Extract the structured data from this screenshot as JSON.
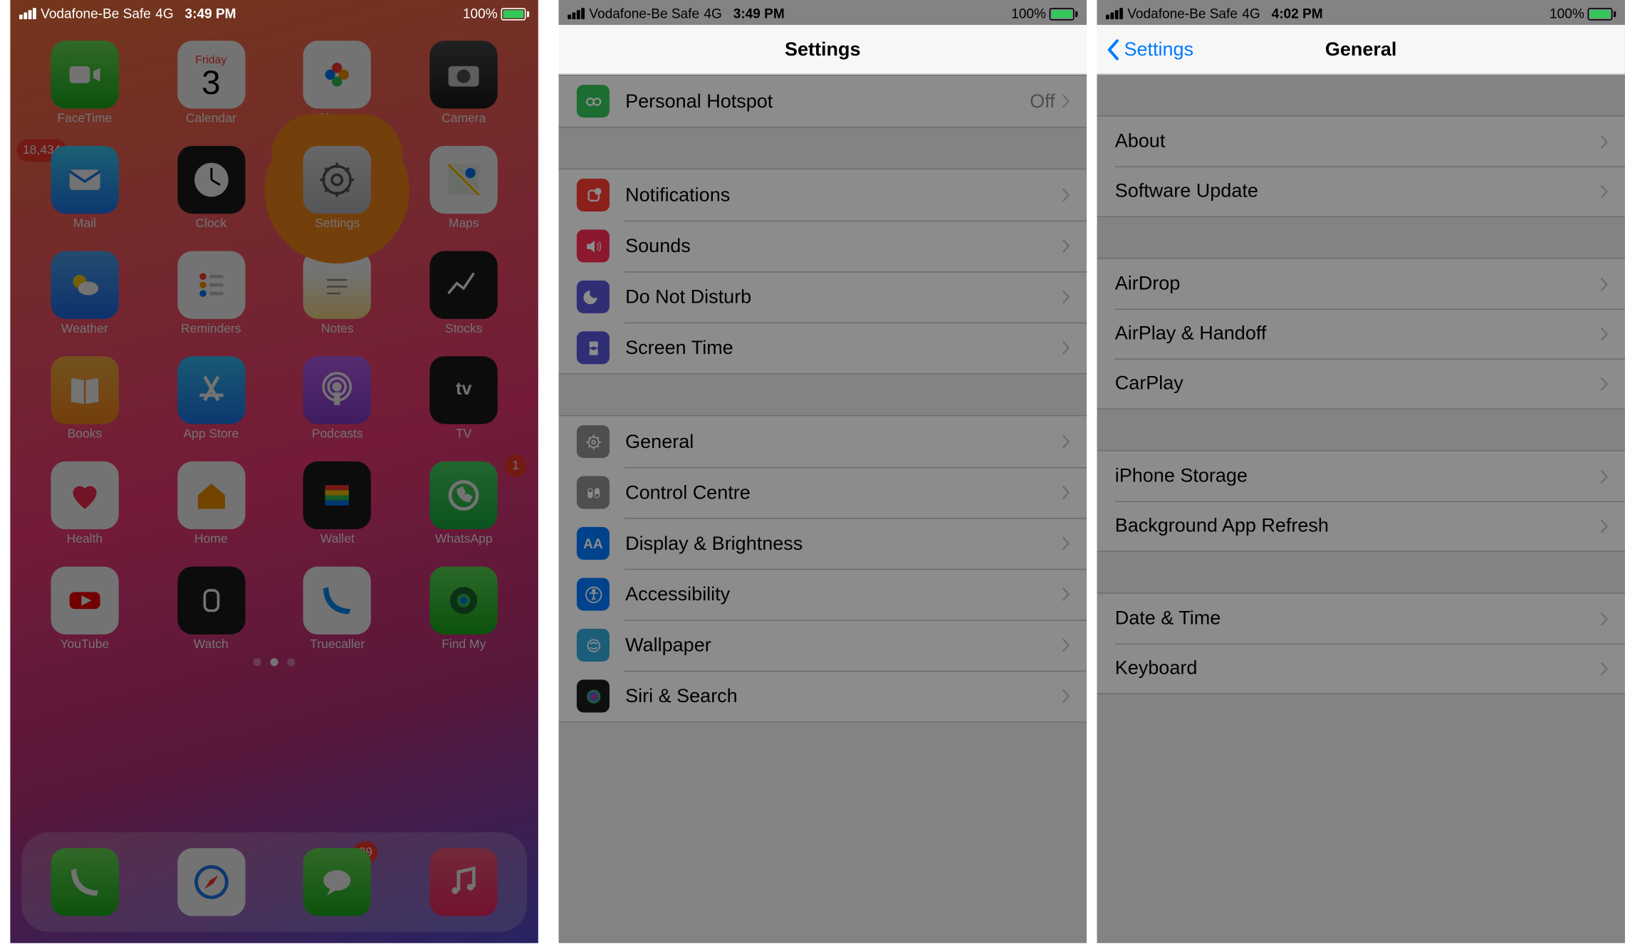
{
  "status": {
    "carrier": "Vodafone-Be Safe",
    "network": "4G",
    "time1": "3:49 PM",
    "time2": "3:49 PM",
    "time3": "4:02 PM",
    "battery": "100%"
  },
  "home": {
    "calendar_day": "Friday",
    "calendar_date": "3",
    "apps": {
      "facetime": "FaceTime",
      "calendar": "Calendar",
      "photos": "Photos",
      "camera": "Camera",
      "mail": "Mail",
      "clock": "Clock",
      "settings": "Settings",
      "maps": "Maps",
      "weather": "Weather",
      "reminders": "Reminders",
      "notes": "Notes",
      "stocks": "Stocks",
      "books": "Books",
      "appstore": "App Store",
      "podcasts": "Podcasts",
      "tv": "TV",
      "health": "Health",
      "home": "Home",
      "wallet": "Wallet",
      "whatsapp": "WhatsApp",
      "youtube": "YouTube",
      "watch": "Watch",
      "truecaller": "Truecaller",
      "findmy": "Find My"
    },
    "badges": {
      "mail": "18,434",
      "whatsapp": "1",
      "messages": "39"
    }
  },
  "settings": {
    "title": "Settings",
    "rows": {
      "hotspot": "Personal Hotspot",
      "hotspot_value": "Off",
      "notifications": "Notifications",
      "sounds": "Sounds",
      "dnd": "Do Not Disturb",
      "screentime": "Screen Time",
      "general": "General",
      "control": "Control Centre",
      "display": "Display & Brightness",
      "accessibility": "Accessibility",
      "wallpaper": "Wallpaper",
      "siri": "Siri & Search"
    }
  },
  "general": {
    "back": "Settings",
    "title": "General",
    "rows": {
      "about": "About",
      "software_update": "Software Update",
      "airdrop": "AirDrop",
      "airplay": "AirPlay & Handoff",
      "carplay": "CarPlay",
      "storage": "iPhone Storage",
      "bgrefresh": "Background App Refresh",
      "datetime": "Date & Time",
      "keyboard": "Keyboard"
    }
  }
}
